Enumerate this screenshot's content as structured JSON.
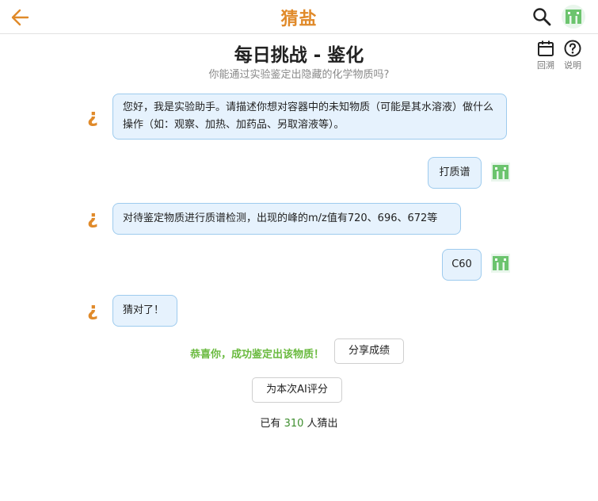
{
  "header": {
    "title": "猜盐",
    "back_icon": "arrow-left-icon",
    "search_icon": "search-icon",
    "avatar_icon": "pixel-avatar-icon"
  },
  "challenge": {
    "title": "每日挑战 - 鉴化",
    "subtitle": "你能通过实验鉴定出隐藏的化学物质吗?",
    "history_label": "回溯",
    "help_label": "说明"
  },
  "messages": [
    {
      "role": "assistant",
      "text": "您好，我是实验助手。请描述你想对容器中的未知物质（可能是其水溶液）做什么操作（如：观察、加热、加药品、另取溶液等）。"
    },
    {
      "role": "user",
      "text": "打质谱"
    },
    {
      "role": "assistant",
      "text": "对待鉴定物质进行质谱检测，出现的峰的m/z值有720、696、672等"
    },
    {
      "role": "user",
      "text": "C60"
    },
    {
      "role": "assistant",
      "text": "猜对了！"
    }
  ],
  "result": {
    "congrats": "恭喜你，成功鉴定出该物质！",
    "share_label": "分享成绩",
    "rate_label": "为本次AI评分",
    "count_prefix": "已有",
    "count": "310",
    "count_suffix": "人猜出"
  },
  "colors": {
    "accent": "#e08a2a",
    "bubble_bg": "#e6f2fd",
    "bubble_border": "#9ecbee",
    "success": "#6aba3f",
    "count": "#3e8e2e"
  }
}
